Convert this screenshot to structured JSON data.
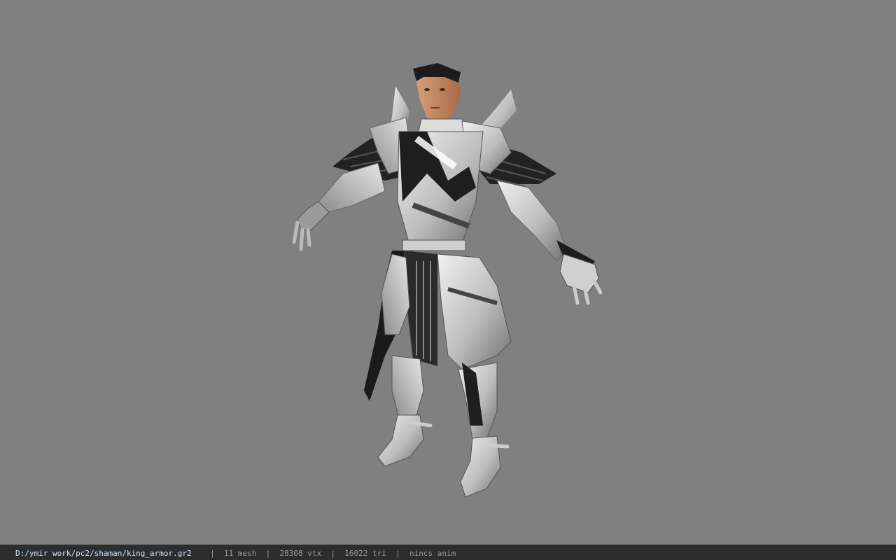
{
  "viewport": {
    "background": "#808080",
    "model_name": "king_armor"
  },
  "status": {
    "path": "D:/ymir work/pc2/shaman/king_armor.gr2",
    "mesh": "11 mesh",
    "vtx": "28308 vtx",
    "tri": "16022 tri",
    "anim": "nincs anim",
    "separator": "|"
  }
}
